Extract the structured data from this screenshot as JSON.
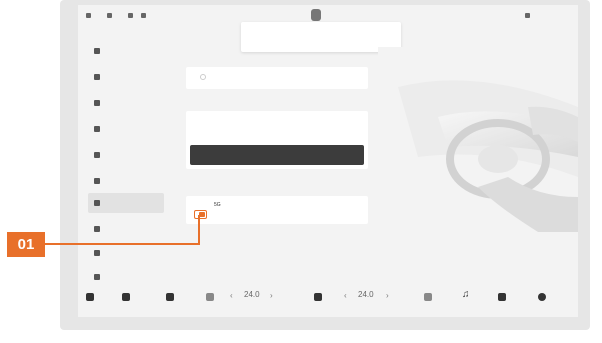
{
  "statusbar": {
    "left_items": [
      "",
      ""
    ],
    "right_items": [
      "",
      "",
      ""
    ]
  },
  "toast": {
    "text": ""
  },
  "sidebar": {
    "items": [
      {
        "label": "",
        "icon": "car-icon"
      },
      {
        "label": "",
        "icon": "light-icon"
      },
      {
        "label": "",
        "icon": "seat-icon"
      },
      {
        "label": "",
        "icon": "wheel-icon"
      },
      {
        "label": "",
        "icon": "drive-icon"
      },
      {
        "label": "",
        "icon": "settings-icon"
      },
      {
        "label": "",
        "icon": "link-icon",
        "active": true
      },
      {
        "label": "",
        "icon": "sound-icon"
      },
      {
        "label": "",
        "icon": "display-icon"
      },
      {
        "label": "",
        "icon": "info-icon"
      }
    ]
  },
  "content": {
    "section1_label": "",
    "card1_title": "",
    "section2_label": "",
    "card2_title": "",
    "card2_sub": "",
    "button_label": "",
    "section3_label": "",
    "card3_title": "5G",
    "card3_sub": ""
  },
  "dock": {
    "temp_left": "24.0",
    "temp_right": "24.0"
  },
  "callout": {
    "label": "01"
  },
  "colors": {
    "accent": "#e8702a",
    "button": "#3c3c3c"
  }
}
